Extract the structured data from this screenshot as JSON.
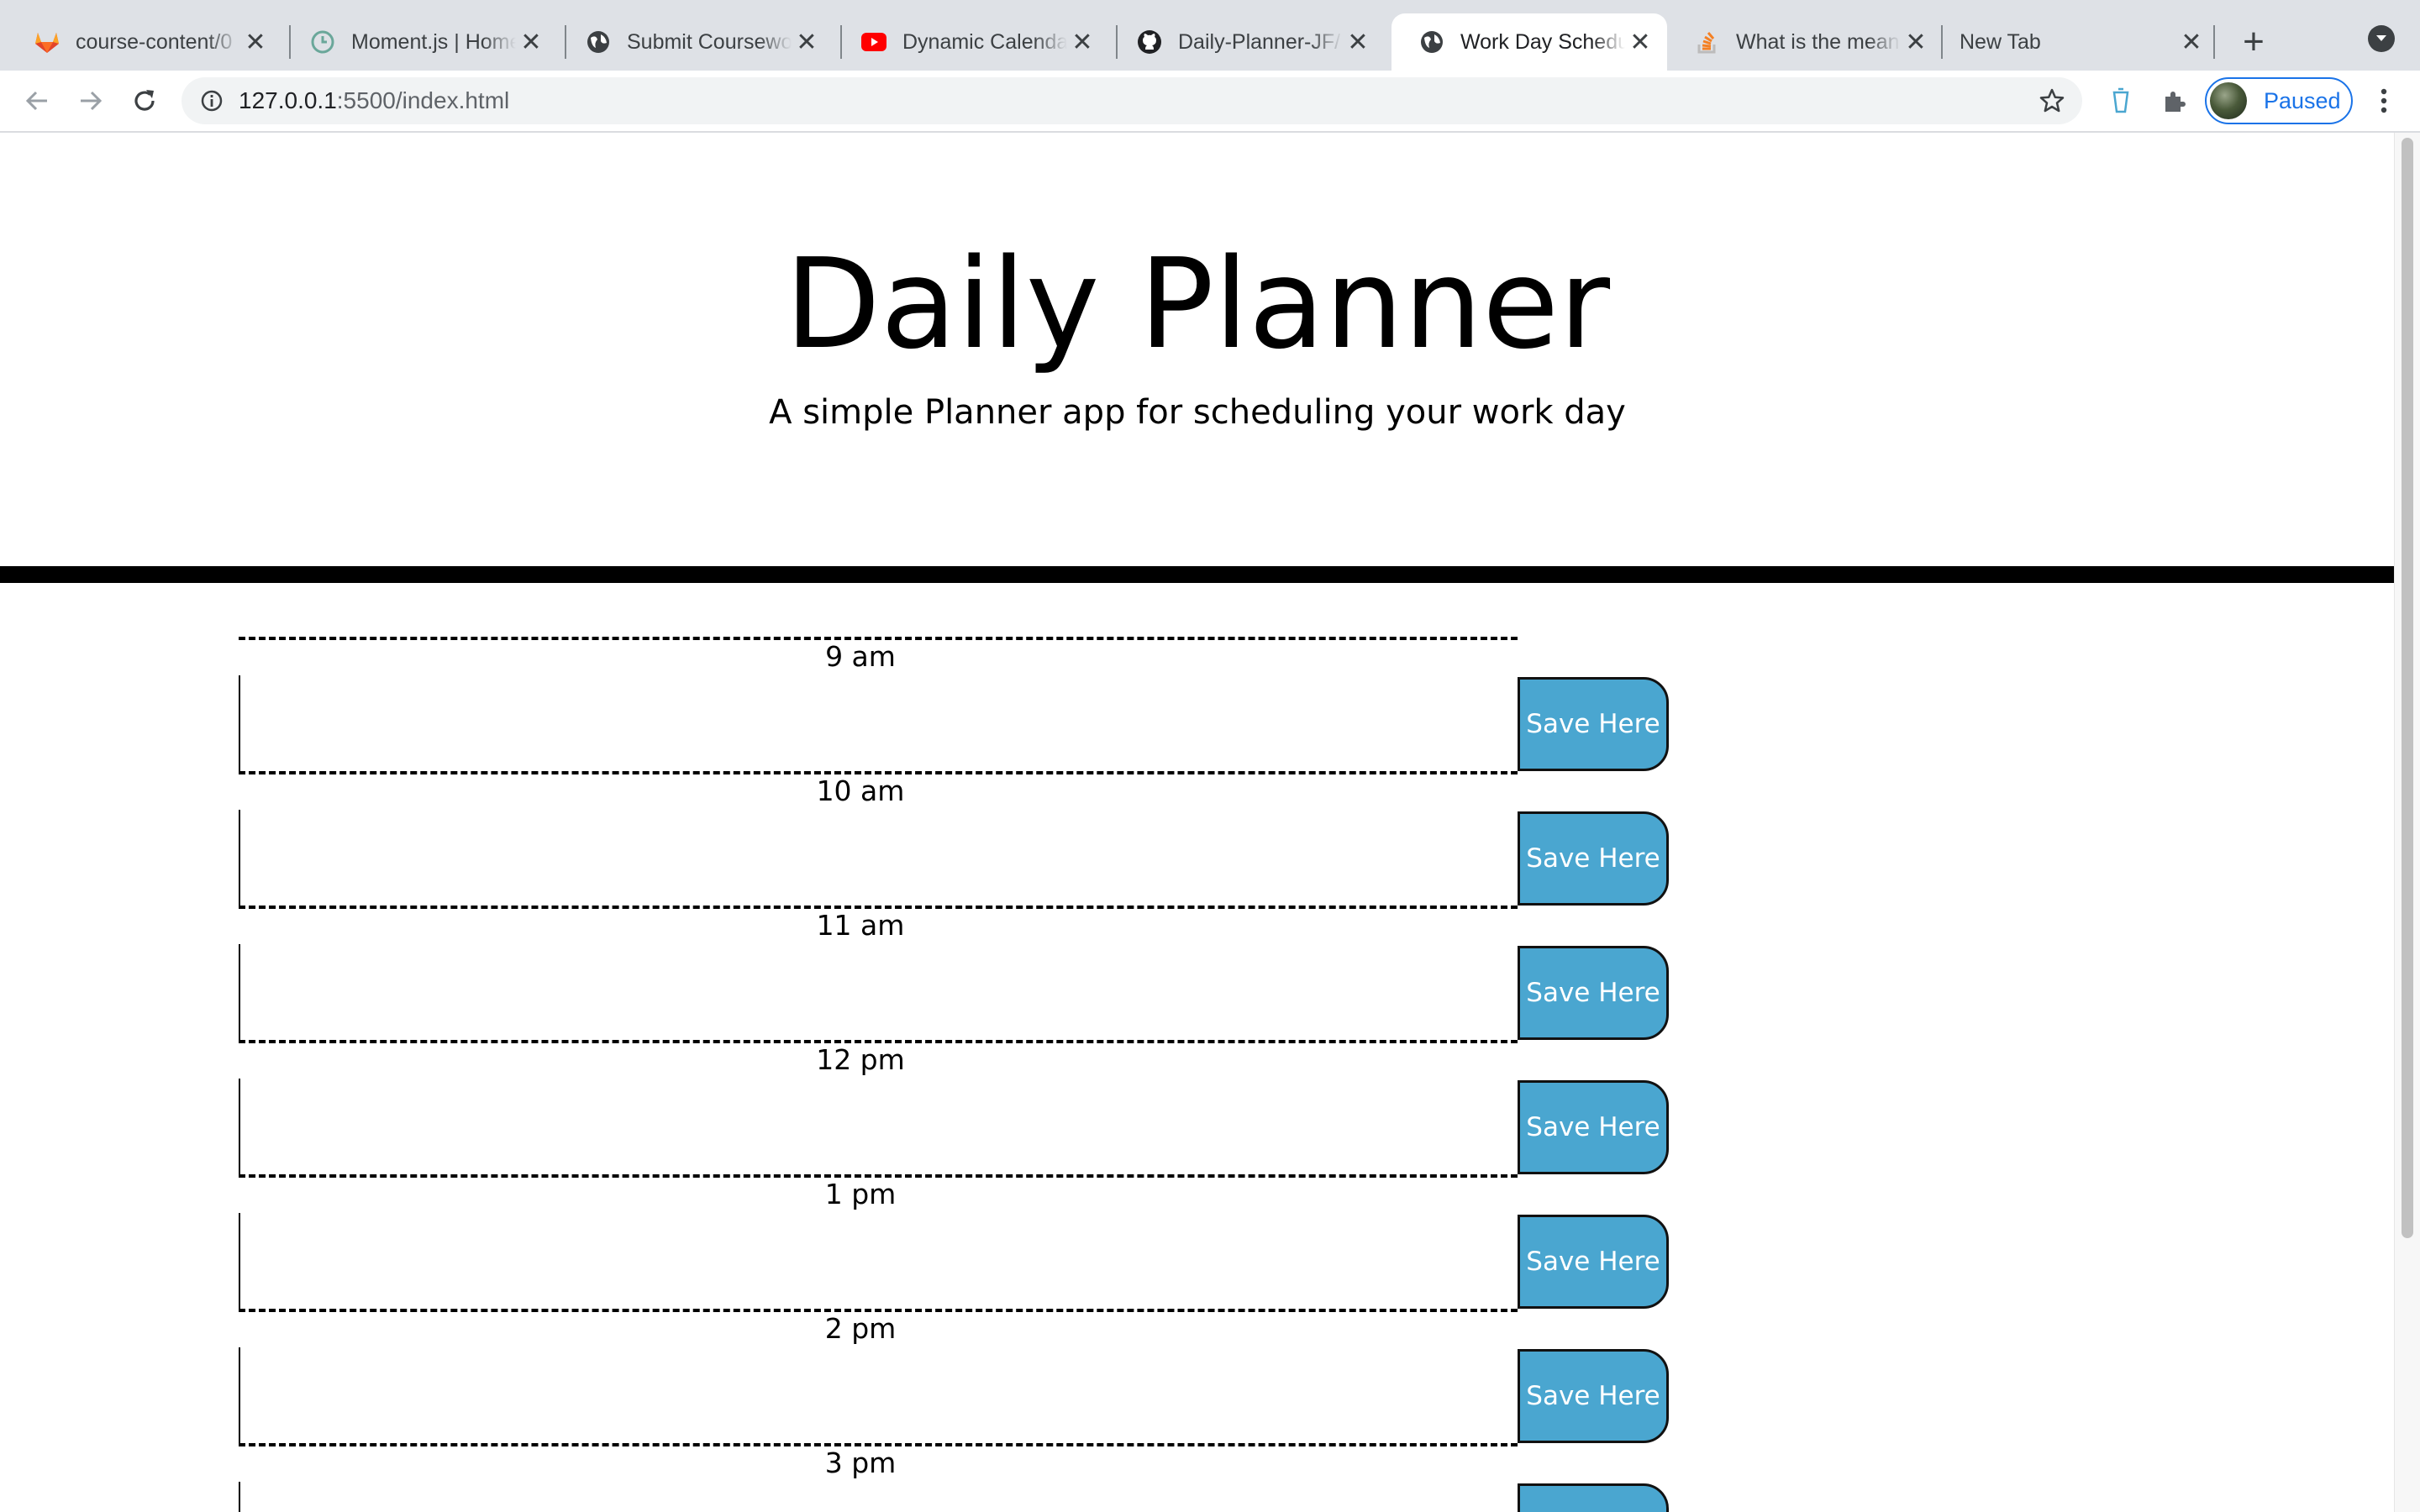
{
  "browser": {
    "tabs": [
      {
        "title": "course-content/0",
        "icon": "gitlab-icon",
        "active": false
      },
      {
        "title": "Moment.js | Home",
        "icon": "clock-icon",
        "active": false
      },
      {
        "title": "Submit Coursework",
        "icon": "globe-icon",
        "active": false
      },
      {
        "title": "Dynamic Calendar",
        "icon": "youtube-icon",
        "active": false
      },
      {
        "title": "Daily-Planner-JF/",
        "icon": "github-icon",
        "active": false
      },
      {
        "title": "Work Day Schedule",
        "icon": "globe-icon",
        "active": true
      },
      {
        "title": "What is the meaning",
        "icon": "stackoverflow-icon",
        "active": false
      },
      {
        "title": "New Tab",
        "icon": "",
        "active": false
      }
    ],
    "url": {
      "host": "127.0.0.1",
      "rest": ":5500/index.html"
    },
    "profile_label": "Paused",
    "colors": {
      "accent": "#1a73e8",
      "tabstrip": "#dee1e6"
    }
  },
  "page": {
    "title": "Daily Planner",
    "subtitle": "A simple Planner app for scheduling your work day",
    "save_label": "Save Here",
    "hours": [
      {
        "label": "9 am"
      },
      {
        "label": "10 am"
      },
      {
        "label": "11 am"
      },
      {
        "label": "12 pm"
      },
      {
        "label": "1 pm"
      },
      {
        "label": "2 pm"
      },
      {
        "label": "3 pm"
      }
    ],
    "colors": {
      "save_button": "#4aa6d0"
    }
  }
}
